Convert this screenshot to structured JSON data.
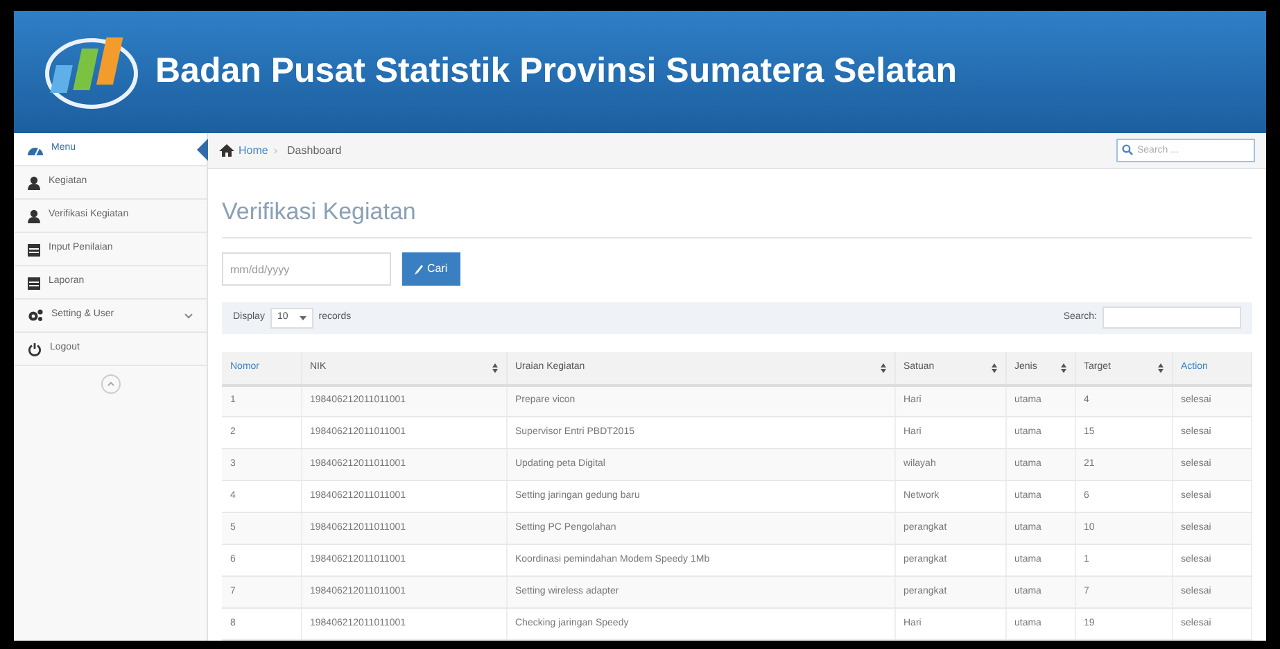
{
  "header": {
    "title": "Badan Pusat Statistik Provinsi Sumatera Selatan"
  },
  "sidebar": {
    "items": [
      {
        "label": "Menu",
        "kind": "menu",
        "selected": true
      },
      {
        "label": "Kegiatan",
        "kind": "user",
        "selected": false
      },
      {
        "label": "Verifikasi Kegiatan",
        "kind": "user",
        "selected": false
      },
      {
        "label": "Input Penilaian",
        "kind": "calendar",
        "selected": false
      },
      {
        "label": "Laporan",
        "kind": "calendar",
        "selected": false
      },
      {
        "label": "Setting & User",
        "kind": "gears",
        "selected": false,
        "expandable": true
      },
      {
        "label": "Logout",
        "kind": "power",
        "selected": false
      }
    ]
  },
  "breadcrumb": [
    "Home",
    "Dashboard"
  ],
  "breadcrumb_separator": "›",
  "top_search": {
    "placeholder": "Search ..."
  },
  "page_title": "Verifikasi Kegiatan",
  "date_field": {
    "placeholder": "mm/dd/yyyy"
  },
  "search_button": "Cari",
  "table_controls": {
    "display_label": "Display",
    "page_size": "10",
    "records_label": "records",
    "search_label": "Search:"
  },
  "table": {
    "columns": [
      {
        "label": "Nomor",
        "sortable": false,
        "highlighted": true
      },
      {
        "label": "NIK",
        "sortable": true,
        "highlighted": false
      },
      {
        "label": "Uraian Kegiatan",
        "sortable": true,
        "highlighted": false
      },
      {
        "label": "Satuan",
        "sortable": true,
        "highlighted": false
      },
      {
        "label": "Jenis",
        "sortable": true,
        "highlighted": false
      },
      {
        "label": "Target",
        "sortable": true,
        "highlighted": false
      },
      {
        "label": "Action",
        "sortable": false,
        "highlighted": true
      }
    ],
    "rows": [
      [
        "1",
        "198406212011011001",
        "Prepare vicon",
        "Hari",
        "utama",
        "4",
        "selesai"
      ],
      [
        "2",
        "198406212011011001",
        "Supervisor Entri PBDT2015",
        "Hari",
        "utama",
        "15",
        "selesai"
      ],
      [
        "3",
        "198406212011011001",
        "Updating peta Digital",
        "wilayah",
        "utama",
        "21",
        "selesai"
      ],
      [
        "4",
        "198406212011011001",
        "Setting jaringan gedung baru",
        "Network",
        "utama",
        "6",
        "selesai"
      ],
      [
        "5",
        "198406212011011001",
        "Setting PC Pengolahan",
        "perangkat",
        "utama",
        "10",
        "selesai"
      ],
      [
        "6",
        "198406212011011001",
        "Koordinasi pemindahan Modem Speedy 1Mb",
        "perangkat",
        "utama",
        "1",
        "selesai"
      ],
      [
        "7",
        "198406212011011001",
        "Setting wireless adapter",
        "perangkat",
        "utama",
        "7",
        "selesai"
      ],
      [
        "8",
        "198406212011011001",
        "Checking jaringan Speedy",
        "Hari",
        "utama",
        "19",
        "selesai"
      ]
    ]
  }
}
